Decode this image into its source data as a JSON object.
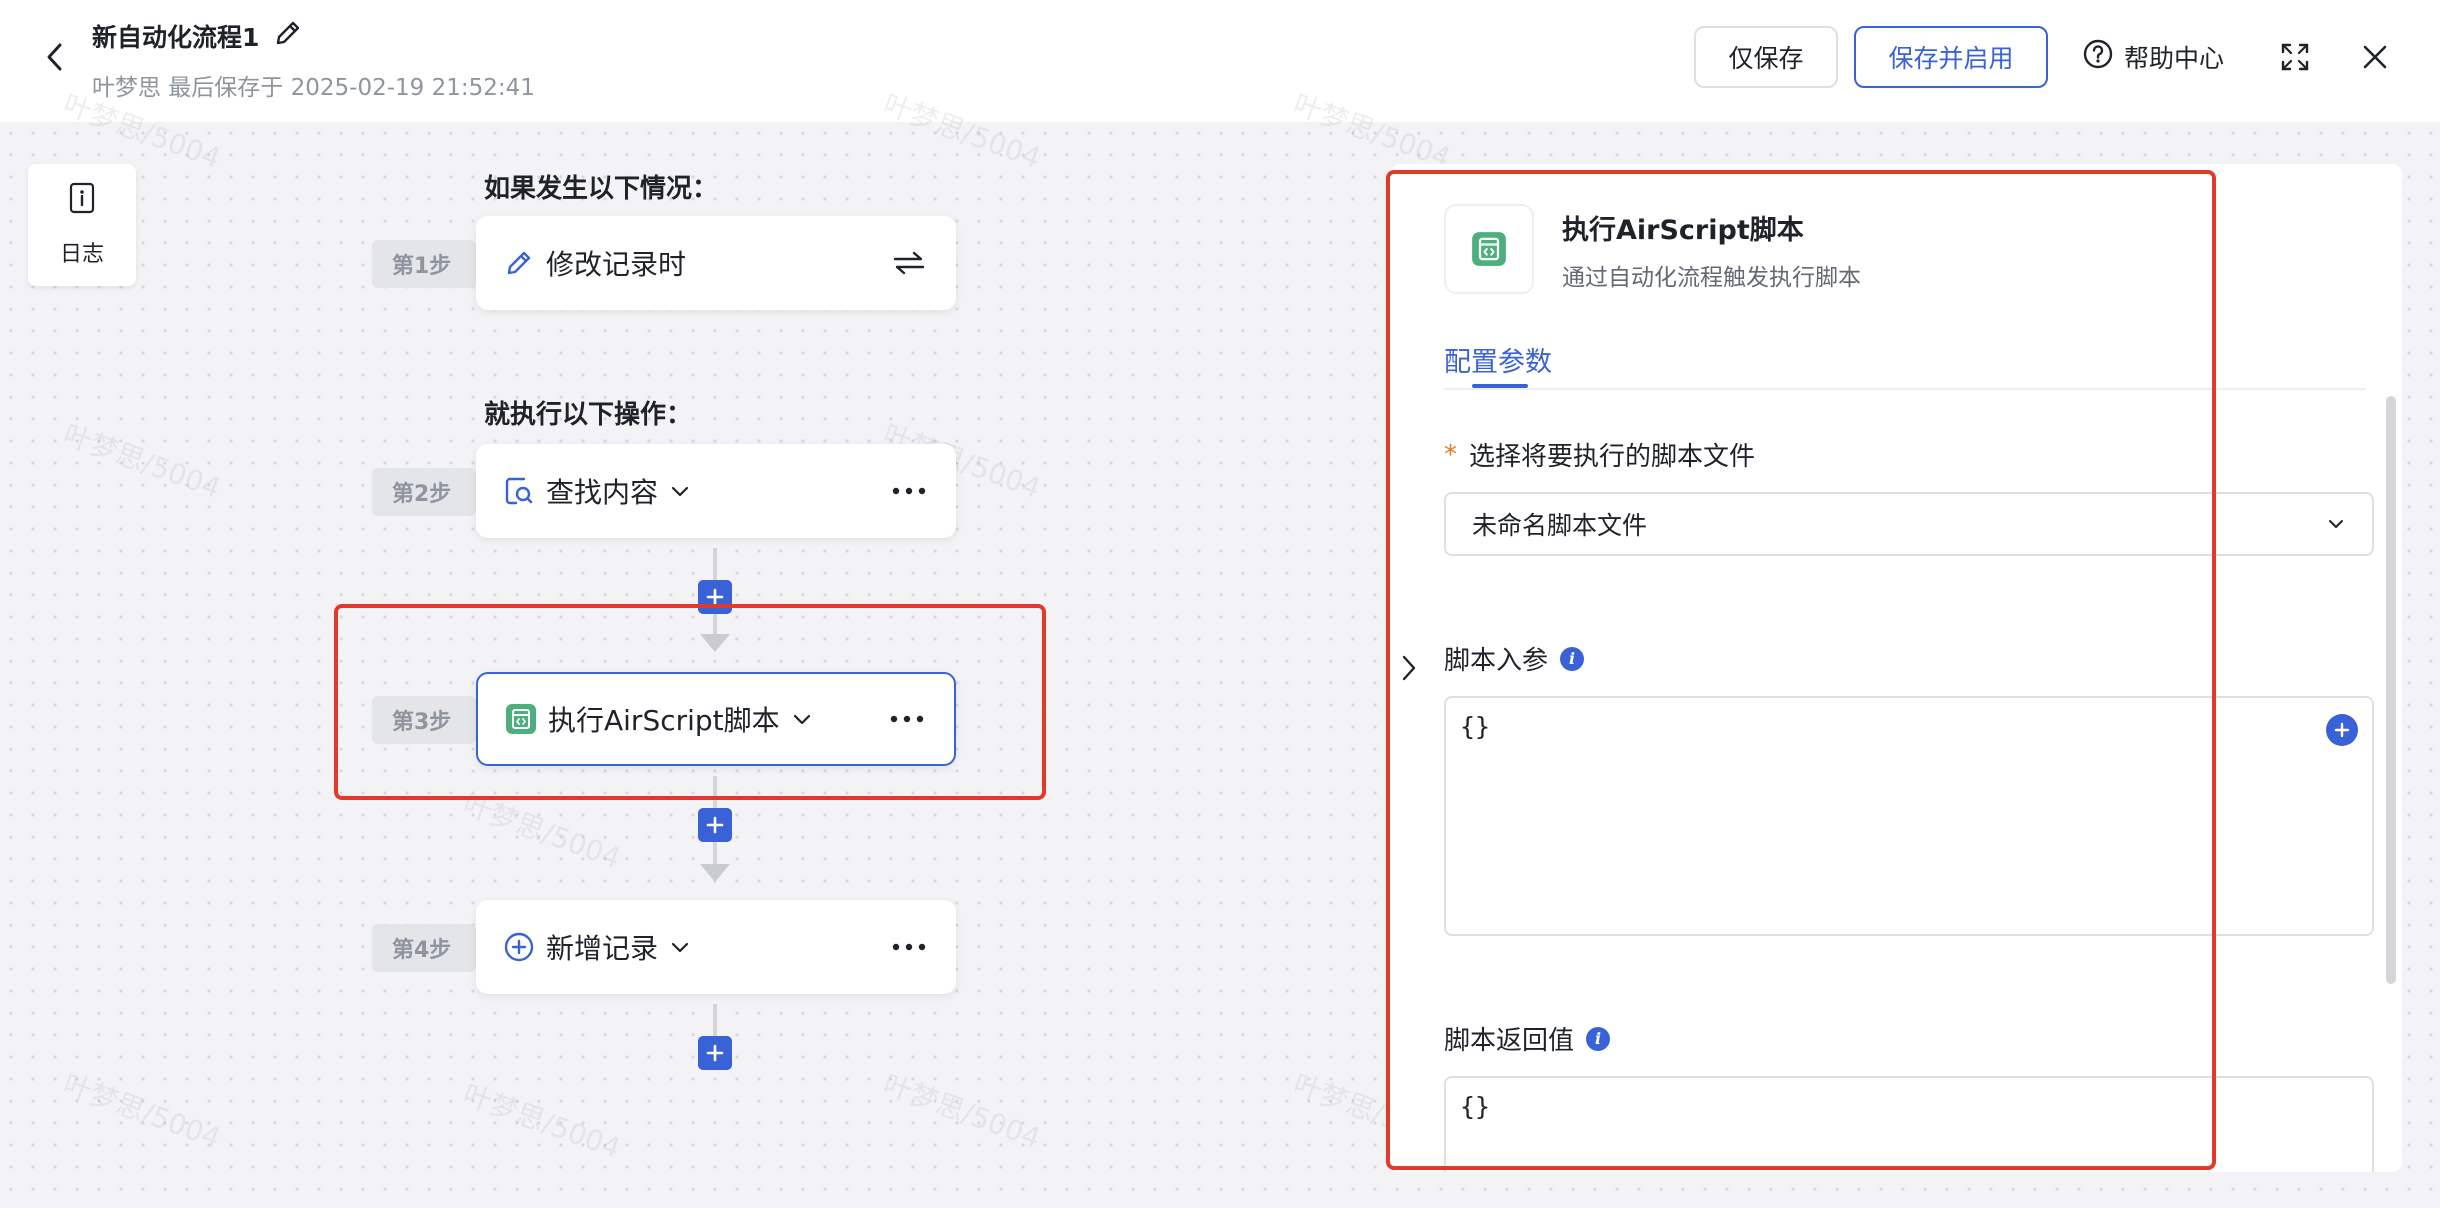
{
  "header": {
    "title": "新自动化流程1",
    "subtitle": "叶梦思 最后保存于 2025-02-19 21:52:41",
    "save_only_label": "仅保存",
    "save_enable_label": "保存并启用",
    "help_label": "帮助中心"
  },
  "sidebar": {
    "log_label": "日志"
  },
  "flow": {
    "trigger_heading": "如果发生以下情况：",
    "action_heading": "就执行以下操作：",
    "steps": [
      {
        "tag": "第1步",
        "label": "修改记录时"
      },
      {
        "tag": "第2步",
        "label": "查找内容"
      },
      {
        "tag": "第3步",
        "label": "执行AirScript脚本"
      },
      {
        "tag": "第4步",
        "label": "新增记录"
      }
    ]
  },
  "watermark": "叶梦思/5004",
  "panel": {
    "title": "执行AirScript脚本",
    "description": "通过自动化流程触发执行脚本",
    "tab_label": "配置参数",
    "script_file": {
      "required_mark": "*",
      "label": "选择将要执行的脚本文件",
      "value": "未命名脚本文件"
    },
    "input_params": {
      "label": "脚本入参",
      "value": "{}"
    },
    "return_value": {
      "label": "脚本返回值",
      "value": "{}"
    }
  },
  "colors": {
    "accent": "#3a62d7",
    "highlight": "#e23a2a",
    "script_icon": "#4caf7d"
  }
}
